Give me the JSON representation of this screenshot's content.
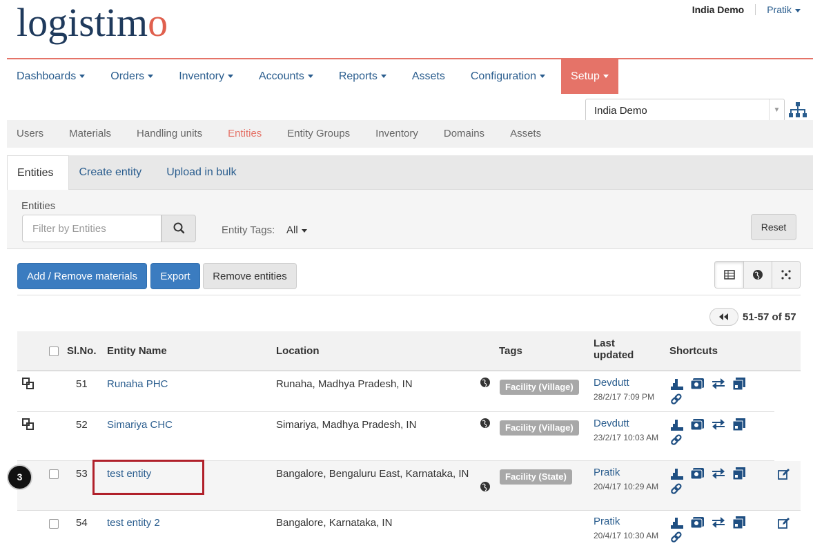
{
  "logo": {
    "part1": "logistim",
    "part2": "o"
  },
  "topbar": {
    "domain": "India Demo",
    "user": "Pratik"
  },
  "mainnav": [
    "Dashboards",
    "Orders",
    "Inventory",
    "Accounts",
    "Reports",
    "Assets",
    "Configuration",
    "Setup"
  ],
  "domain_select": {
    "value": "India Demo"
  },
  "subnav": [
    "Users",
    "Materials",
    "Handling units",
    "Entities",
    "Entity Groups",
    "Inventory",
    "Domains",
    "Assets"
  ],
  "tabs": [
    "Entities",
    "Create entity",
    "Upload in bulk"
  ],
  "filter": {
    "label": "Entities",
    "placeholder": "Filter by Entities",
    "tags_label": "Entity Tags:",
    "tags_value": "All",
    "reset": "Reset"
  },
  "actions": {
    "add_remove": "Add / Remove materials",
    "export": "Export",
    "remove": "Remove entities"
  },
  "pager": {
    "text": "51-57 of 57"
  },
  "table": {
    "headers": {
      "slno": "Sl.No.",
      "name": "Entity Name",
      "location": "Location",
      "tags": "Tags",
      "last_updated_1": "Last",
      "last_updated_2": "updated",
      "shortcuts": "Shortcuts"
    },
    "rows": [
      {
        "slno": "51",
        "name": "Runaha PHC",
        "location": "Runaha, Madhya Pradesh, IN",
        "tag": "Facility (Village)",
        "user": "Devdutt",
        "date": "28/2/17 7:09 PM"
      },
      {
        "slno": "52",
        "name": "Simariya CHC",
        "location": "Simariya, Madhya Pradesh, IN",
        "tag": "Facility (Village)",
        "user": "Devdutt",
        "date": "23/2/17 10:03 AM"
      },
      {
        "slno": "53",
        "name": "test entity",
        "location": "Bangalore, Bengaluru East, Karnataka, IN",
        "tag": "Facility (State)",
        "user": "Pratik",
        "date": "20/4/17 10:29 AM"
      },
      {
        "slno": "54",
        "name": "test entity 2",
        "location": "Bangalore, Karnataka, IN",
        "tag": "",
        "user": "Pratik",
        "date": "20/4/17 10:30 AM"
      }
    ]
  },
  "step_badge": "3",
  "colors": {
    "accent": "#e57368",
    "link": "#2a5d8e",
    "primary": "#3b7cc0",
    "highlight": "#b0202a"
  }
}
